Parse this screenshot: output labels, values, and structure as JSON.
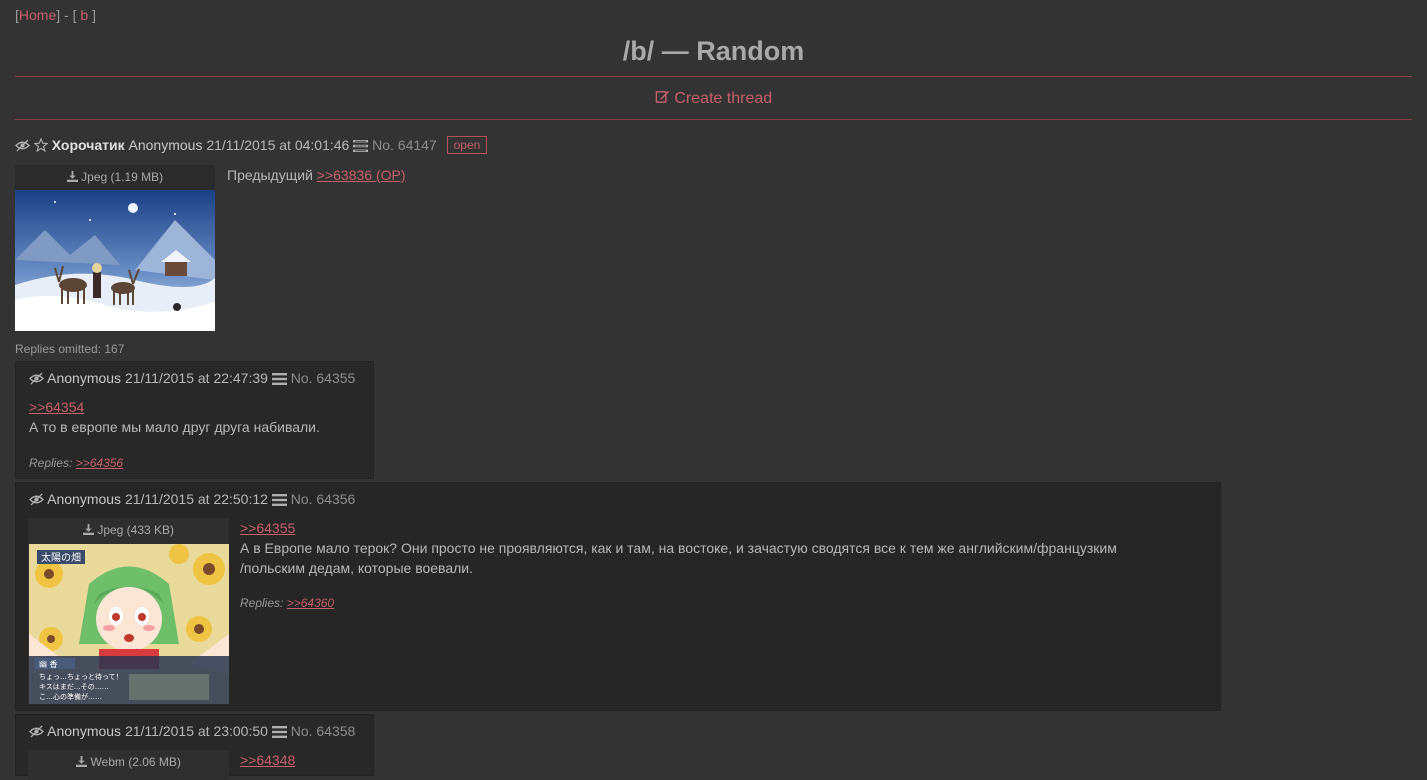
{
  "nav": {
    "open_bracket": "[",
    "home": "Home",
    "separator": "] - [",
    "board": "b",
    "close_bracket": "]"
  },
  "board_title": "/b/ — Random",
  "create_thread": "Create thread",
  "op": {
    "subject": "Хорочатик",
    "name": "Anonymous",
    "date": "21/11/2015 at 04:01:46",
    "number": "No. 64147",
    "badge": "open",
    "file_info": "Jpeg (1.19 MB)",
    "text": "Предыдущий",
    "link": ">>63836 (OP)",
    "replies_omitted": "Replies omitted: 167"
  },
  "replies": [
    {
      "name": "Anonymous",
      "date": "21/11/2015 at 22:47:39",
      "number": "No. 64355",
      "quote": ">>64354",
      "text": "А то в европе мы мало друг друга набивали.",
      "replies_label": "Replies:",
      "reply_link": ">>64356"
    },
    {
      "name": "Anonymous",
      "date": "21/11/2015 at 22:50:12",
      "number": "No. 64356",
      "file_info": "Jpeg (433 KB)",
      "quote": ">>64355",
      "text_line1": "А в Европе мало терок? Они просто не проявляются, как и там, на востоке, и зачастую сводятся все к тем же английским/французким",
      "text_line2": "/польским дедам, которые воевали.",
      "replies_label": "Replies:",
      "reply_link": ">>64360"
    },
    {
      "name": "Anonymous",
      "date": "21/11/2015 at 23:00:50",
      "number": "No. 64358",
      "file_info": "Webm (2.06 MB)",
      "quote": ">>64348"
    }
  ],
  "thumb2_texts": {
    "tag": "太陽の畑",
    "name": "幽 香",
    "line1": "ちょっ…ちょっと待って！",
    "line2": "キスはまだ…その……",
    "line3": "こ…心の準備が……"
  },
  "colors": {
    "background": "#333333",
    "reply_background": "#282828",
    "accent_link": "#c4606a",
    "rule": "#8a4048"
  }
}
